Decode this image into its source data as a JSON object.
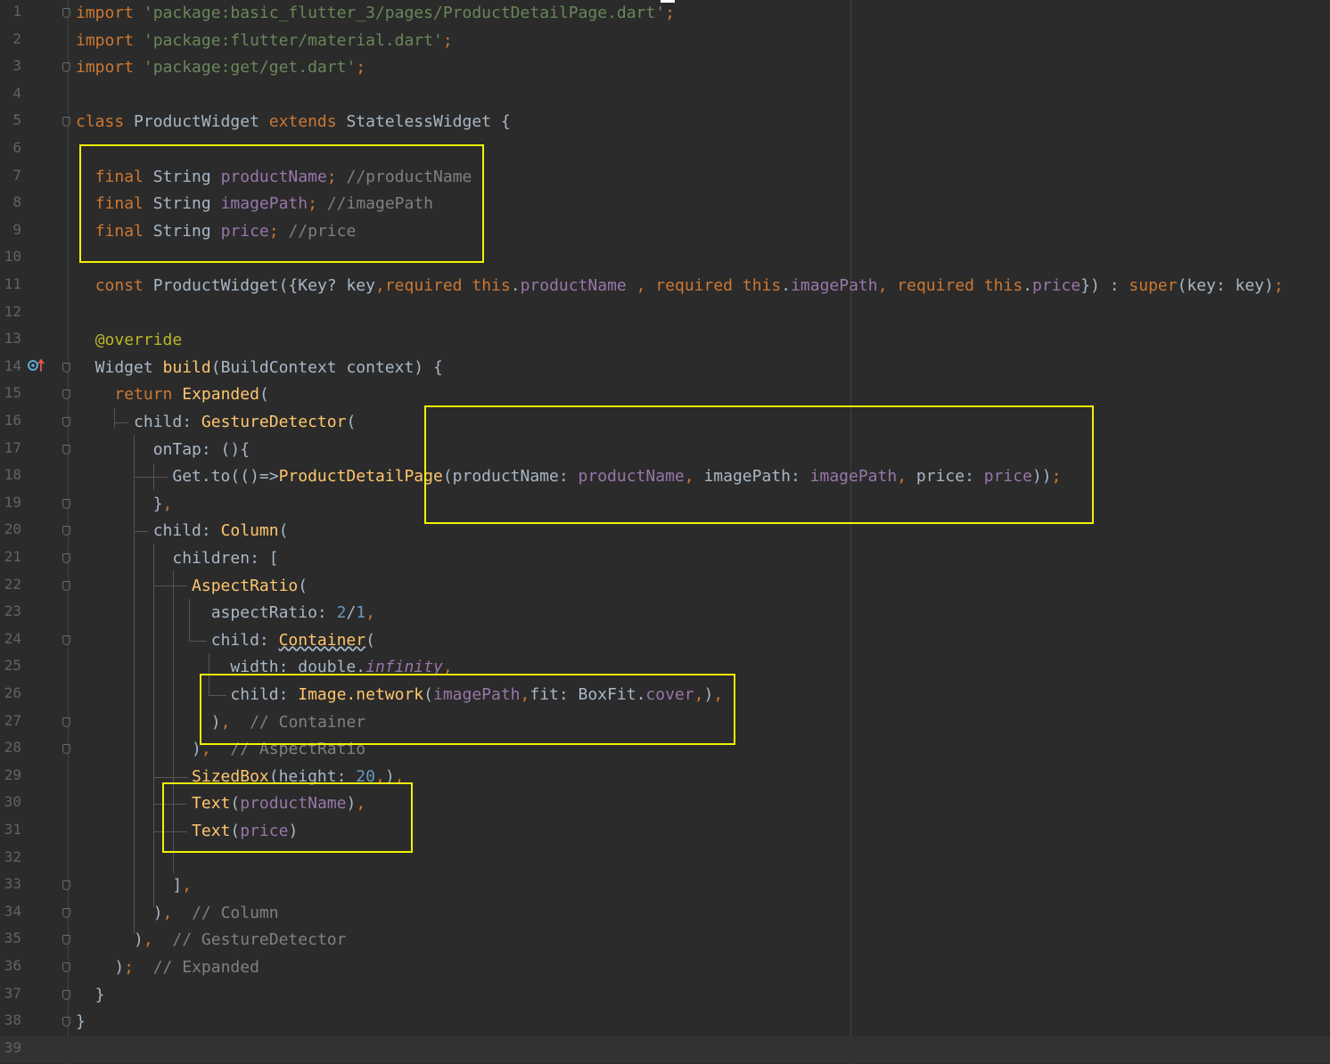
{
  "editor": {
    "lines": [
      {
        "n": "1",
        "parts": [
          {
            "t": "import",
            "c": "k"
          },
          {
            "t": " "
          },
          {
            "t": "'package:basic_flutter_3/pages/ProductDetailPage.dart'",
            "c": "s"
          },
          {
            "t": ";",
            "c": "k"
          }
        ]
      },
      {
        "n": "2",
        "parts": [
          {
            "t": "import",
            "c": "k"
          },
          {
            "t": " "
          },
          {
            "t": "'package:flutter/material.dart'",
            "c": "s"
          },
          {
            "t": ";",
            "c": "k"
          }
        ]
      },
      {
        "n": "3",
        "parts": [
          {
            "t": "import",
            "c": "k"
          },
          {
            "t": " "
          },
          {
            "t": "'package:get/get.dart'",
            "c": "s"
          },
          {
            "t": ";",
            "c": "k"
          }
        ]
      },
      {
        "n": "4",
        "parts": []
      },
      {
        "n": "5",
        "parts": [
          {
            "t": "class",
            "c": "k"
          },
          {
            "t": " ProductWidget "
          },
          {
            "t": "extends",
            "c": "k"
          },
          {
            "t": " StatelessWidget {"
          }
        ]
      },
      {
        "n": "6",
        "parts": []
      },
      {
        "n": "7",
        "parts": [
          {
            "t": "  "
          },
          {
            "t": "final",
            "c": "k"
          },
          {
            "t": " String "
          },
          {
            "t": "productName",
            "c": "f"
          },
          {
            "t": ";",
            "c": "k"
          },
          {
            "t": " "
          },
          {
            "t": "//productName",
            "c": "c"
          }
        ]
      },
      {
        "n": "8",
        "parts": [
          {
            "t": "  "
          },
          {
            "t": "final",
            "c": "k"
          },
          {
            "t": " String "
          },
          {
            "t": "imagePath",
            "c": "f"
          },
          {
            "t": ";",
            "c": "k"
          },
          {
            "t": " "
          },
          {
            "t": "//imagePath",
            "c": "c"
          }
        ]
      },
      {
        "n": "9",
        "parts": [
          {
            "t": "  "
          },
          {
            "t": "final",
            "c": "k"
          },
          {
            "t": " String "
          },
          {
            "t": "price",
            "c": "f"
          },
          {
            "t": ";",
            "c": "k"
          },
          {
            "t": " "
          },
          {
            "t": "//price",
            "c": "c"
          }
        ]
      },
      {
        "n": "10",
        "parts": []
      },
      {
        "n": "11",
        "parts": [
          {
            "t": "  "
          },
          {
            "t": "const",
            "c": "k"
          },
          {
            "t": " ProductWidget({Key? key"
          },
          {
            "t": ",",
            "c": "k"
          },
          {
            "t": "required",
            "c": "k"
          },
          {
            "t": " "
          },
          {
            "t": "this",
            "c": "k"
          },
          {
            "t": "."
          },
          {
            "t": "productName",
            "c": "f"
          },
          {
            "t": " "
          },
          {
            "t": ", ",
            "c": "k"
          },
          {
            "t": "required",
            "c": "k"
          },
          {
            "t": " "
          },
          {
            "t": "this",
            "c": "k"
          },
          {
            "t": "."
          },
          {
            "t": "imagePath",
            "c": "f"
          },
          {
            "t": ", ",
            "c": "k"
          },
          {
            "t": "required",
            "c": "k"
          },
          {
            "t": " "
          },
          {
            "t": "this",
            "c": "k"
          },
          {
            "t": "."
          },
          {
            "t": "price",
            "c": "f"
          },
          {
            "t": "}) : "
          },
          {
            "t": "super",
            "c": "k"
          },
          {
            "t": "(key: key)"
          },
          {
            "t": ";",
            "c": "k"
          }
        ]
      },
      {
        "n": "12",
        "parts": []
      },
      {
        "n": "13",
        "parts": [
          {
            "t": "  "
          },
          {
            "t": "@override",
            "c": "an"
          }
        ]
      },
      {
        "n": "14",
        "parts": [
          {
            "t": "  Widget "
          },
          {
            "t": "build",
            "c": "fn"
          },
          {
            "t": "(BuildContext context) {"
          }
        ]
      },
      {
        "n": "15",
        "parts": [
          {
            "t": "    "
          },
          {
            "t": "return",
            "c": "k"
          },
          {
            "t": " "
          },
          {
            "t": "Expanded",
            "c": "fn"
          },
          {
            "t": "("
          }
        ]
      },
      {
        "n": "16",
        "parts": [
          {
            "t": "      child: "
          },
          {
            "t": "GestureDetector",
            "c": "fn"
          },
          {
            "t": "("
          }
        ]
      },
      {
        "n": "17",
        "parts": [
          {
            "t": "        onTap: (){"
          }
        ]
      },
      {
        "n": "18",
        "parts": [
          {
            "t": "          Get.to(()=>"
          },
          {
            "t": "ProductDetailPage",
            "c": "fn"
          },
          {
            "t": "(productName: "
          },
          {
            "t": "productName",
            "c": "f"
          },
          {
            "t": ", ",
            "c": "k"
          },
          {
            "t": "imagePath: "
          },
          {
            "t": "imagePath",
            "c": "f"
          },
          {
            "t": ", ",
            "c": "k"
          },
          {
            "t": "price: "
          },
          {
            "t": "price",
            "c": "f"
          },
          {
            "t": "))"
          },
          {
            "t": ";",
            "c": "k"
          }
        ]
      },
      {
        "n": "19",
        "parts": [
          {
            "t": "        }"
          },
          {
            "t": ",",
            "c": "k"
          }
        ]
      },
      {
        "n": "20",
        "parts": [
          {
            "t": "        child: "
          },
          {
            "t": "Column",
            "c": "fn"
          },
          {
            "t": "("
          }
        ]
      },
      {
        "n": "21",
        "parts": [
          {
            "t": "          children: ["
          }
        ]
      },
      {
        "n": "22",
        "parts": [
          {
            "t": "            "
          },
          {
            "t": "AspectRatio",
            "c": "fn"
          },
          {
            "t": "("
          }
        ]
      },
      {
        "n": "23",
        "parts": [
          {
            "t": "              aspectRatio: "
          },
          {
            "t": "2",
            "c": "n"
          },
          {
            "t": "/"
          },
          {
            "t": "1",
            "c": "n"
          },
          {
            "t": ",",
            "c": "k"
          }
        ]
      },
      {
        "n": "24",
        "parts": [
          {
            "t": "              child: "
          },
          {
            "t": "Container",
            "c": "fn ul"
          },
          {
            "t": "("
          }
        ]
      },
      {
        "n": "25",
        "parts": [
          {
            "t": "                width: double."
          },
          {
            "t": "infinity",
            "c": "it"
          },
          {
            "t": ",",
            "c": "k"
          }
        ]
      },
      {
        "n": "26",
        "parts": [
          {
            "t": "                child: "
          },
          {
            "t": "Image.network",
            "c": "fn"
          },
          {
            "t": "("
          },
          {
            "t": "imagePath",
            "c": "f"
          },
          {
            "t": ",",
            "c": "k"
          },
          {
            "t": "fit: BoxFit."
          },
          {
            "t": "cover",
            "c": "f"
          },
          {
            "t": ",",
            "c": "k"
          },
          {
            "t": ")"
          },
          {
            "t": ",",
            "c": "k"
          }
        ]
      },
      {
        "n": "27",
        "parts": [
          {
            "t": "              )"
          },
          {
            "t": ",",
            "c": "k"
          },
          {
            "t": "  "
          },
          {
            "t": "// Container",
            "c": "c"
          }
        ]
      },
      {
        "n": "28",
        "parts": [
          {
            "t": "            )"
          },
          {
            "t": ",",
            "c": "k"
          },
          {
            "t": "  "
          },
          {
            "t": "// AspectRatio",
            "c": "c"
          }
        ]
      },
      {
        "n": "29",
        "parts": [
          {
            "t": "            "
          },
          {
            "t": "SizedBox",
            "c": "fn"
          },
          {
            "t": "(height: "
          },
          {
            "t": "20",
            "c": "n"
          },
          {
            "t": ",",
            "c": "k"
          },
          {
            "t": ")"
          },
          {
            "t": ",",
            "c": "k"
          }
        ]
      },
      {
        "n": "30",
        "parts": [
          {
            "t": "            "
          },
          {
            "t": "Text",
            "c": "fn"
          },
          {
            "t": "("
          },
          {
            "t": "productName",
            "c": "f"
          },
          {
            "t": ")"
          },
          {
            "t": ",",
            "c": "k"
          }
        ]
      },
      {
        "n": "31",
        "parts": [
          {
            "t": "            "
          },
          {
            "t": "Text",
            "c": "fn"
          },
          {
            "t": "("
          },
          {
            "t": "price",
            "c": "f"
          },
          {
            "t": ")"
          }
        ]
      },
      {
        "n": "32",
        "parts": []
      },
      {
        "n": "33",
        "parts": [
          {
            "t": "          ]"
          },
          {
            "t": ",",
            "c": "k"
          }
        ]
      },
      {
        "n": "34",
        "parts": [
          {
            "t": "        )"
          },
          {
            "t": ",",
            "c": "k"
          },
          {
            "t": "  "
          },
          {
            "t": "// Column",
            "c": "c"
          }
        ]
      },
      {
        "n": "35",
        "parts": [
          {
            "t": "      )"
          },
          {
            "t": ",",
            "c": "k"
          },
          {
            "t": "  "
          },
          {
            "t": "// GestureDetector",
            "c": "c"
          }
        ]
      },
      {
        "n": "36",
        "parts": [
          {
            "t": "    )"
          },
          {
            "t": ";",
            "c": "k"
          },
          {
            "t": "  "
          },
          {
            "t": "// Expanded",
            "c": "c"
          }
        ]
      },
      {
        "n": "37",
        "parts": [
          {
            "t": "  }"
          }
        ]
      },
      {
        "n": "38",
        "parts": [
          {
            "t": "}"
          }
        ]
      },
      {
        "n": "39",
        "parts": []
      }
    ],
    "fold_lines": [
      "1",
      "3",
      "5",
      "14",
      "15",
      "16",
      "17",
      "19",
      "20",
      "21",
      "22",
      "24",
      "27",
      "28",
      "33",
      "34",
      "35",
      "36",
      "37",
      "38"
    ],
    "current_line": "39"
  },
  "colors": {
    "background": "#2b2b2b",
    "keyword": "#cc7832",
    "string": "#6a8759",
    "field": "#9876aa",
    "comment": "#808080",
    "number": "#6897bb",
    "function": "#ffc66d",
    "annotation": "#bbb529",
    "text": "#a9b7c6",
    "highlight_box": "#f2f200"
  }
}
